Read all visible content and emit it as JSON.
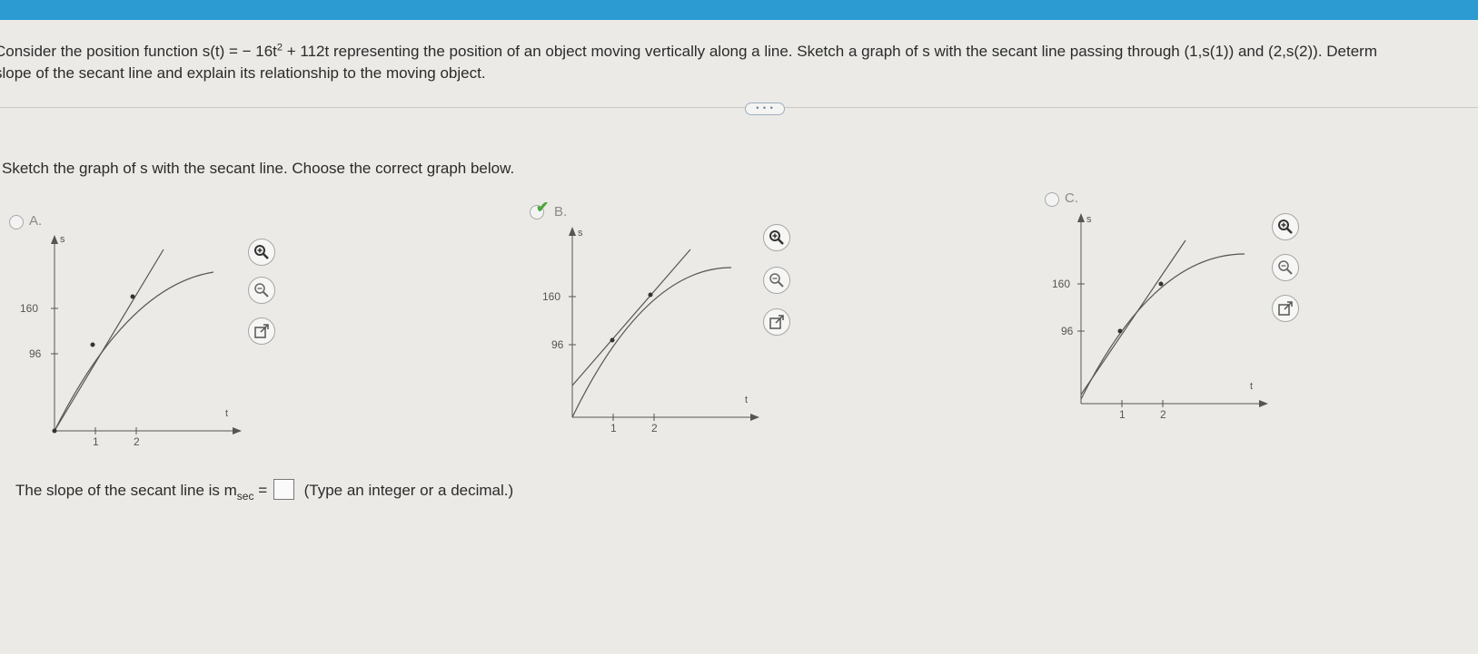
{
  "question": {
    "line1_a": "Consider the position function s(t) = − 16t",
    "line1_sup": "2",
    "line1_b": " + 112t representing the position of an object moving vertically along a line. Sketch a graph of s with the secant line passing through (1,s(1)) and (2,s(2)). Determ",
    "line2": "slope of the secant line and explain its relationship to the moving object."
  },
  "more_button": "• • •",
  "prompt": "Sketch the graph of s with the secant line. Choose the correct graph below.",
  "options": [
    {
      "label": "A.",
      "selected": false,
      "correct": false
    },
    {
      "label": "B.",
      "selected": true,
      "correct": true
    },
    {
      "label": "C.",
      "selected": false,
      "correct": false
    }
  ],
  "graph_labels": {
    "s": "s",
    "t": "t",
    "y160": "160",
    "y96": "96",
    "x1": "1",
    "x2": "2"
  },
  "tools": [
    "zoom-in-icon",
    "zoom-out-icon",
    "open-new-window-icon"
  ],
  "answer": {
    "prefix": "The slope of the secant line is m",
    "sub": "sec",
    "equals": " =",
    "value": "",
    "hint": "(Type an integer or a decimal.)"
  },
  "colors": {
    "accent_bar": "#2b9bd1",
    "check": "#4aa83a",
    "background": "#ebeae6"
  }
}
